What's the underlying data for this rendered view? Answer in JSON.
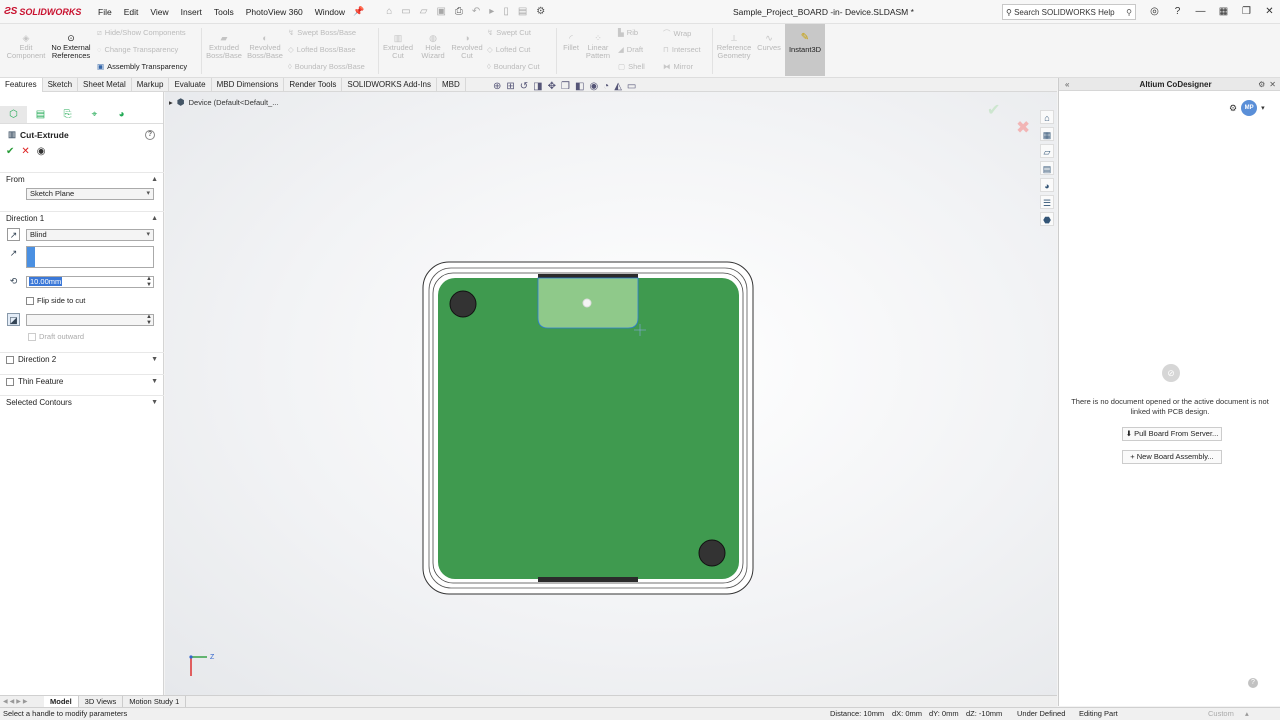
{
  "app": {
    "logo": "SOLIDWORKS",
    "doc_title": "Sample_Project_BOARD -in- Device.SLDASM *",
    "menu": [
      "File",
      "Edit",
      "View",
      "Insert",
      "Tools",
      "PhotoView 360",
      "Window"
    ],
    "search_placeholder": "Search SOLIDWORKS Help"
  },
  "ribbon": {
    "edit_component": "Edit Component",
    "no_external_refs": "No External References",
    "hide_show": "Hide/Show Components",
    "change_transparency": "Change Transparency",
    "assembly_transparency": "Assembly Transparency",
    "extruded_boss": "Extruded Boss/Base",
    "revolved_boss": "Revolved Boss/Base",
    "swept_boss": "Swept Boss/Base",
    "lofted_boss": "Lofted Boss/Base",
    "boundary_boss": "Boundary Boss/Base",
    "extruded_cut": "Extruded Cut",
    "hole_wizard": "Hole Wizard",
    "revolved_cut": "Revolved Cut",
    "swept_cut": "Swept Cut",
    "lofted_cut": "Lofted Cut",
    "boundary_cut": "Boundary Cut",
    "fillet": "Fillet",
    "linear_pattern": "Linear Pattern",
    "rib": "Rib",
    "draft": "Draft",
    "shell": "Shell",
    "wrap": "Wrap",
    "intersect": "Intersect",
    "mirror": "Mirror",
    "reference_geometry": "Reference Geometry",
    "curves": "Curves",
    "instant3d": "Instant3D"
  },
  "tabs": [
    "Features",
    "Sketch",
    "Sheet Metal",
    "Markup",
    "Evaluate",
    "MBD Dimensions",
    "Render Tools",
    "SOLIDWORKS Add-Ins",
    "MBD"
  ],
  "property_manager": {
    "title": "Cut-Extrude",
    "from_label": "From",
    "from_value": "Sketch Plane",
    "direction1_label": "Direction 1",
    "end_condition": "Blind",
    "depth": "10.00mm",
    "flip_side": "Flip side to cut",
    "draft_outward": "Draft outward",
    "direction2_label": "Direction 2",
    "thin_feature": "Thin Feature",
    "selected_contours": "Selected Contours"
  },
  "graphics": {
    "tree_label": "Device  (Default<Default_..."
  },
  "triad": {
    "z_label": "Z"
  },
  "task_pane": {
    "title": "Altium CoDesigner",
    "avatar": "MP",
    "no_doc_msg": "There is no document opened or the active document is not linked with PCB design.",
    "pull_btn": "Pull Board From Server...",
    "new_btn": "New Board Assembly..."
  },
  "bottom_tabs": [
    "Model",
    "3D Views",
    "Motion Study 1"
  ],
  "status": {
    "left": "Select a handle to modify parameters",
    "distance": "Distance: 10mm",
    "dx": "dX: 0mm",
    "dy": "dY: 0mm",
    "dz": "dZ: -10mm",
    "defined": "Under Defined",
    "mode": "Editing Part",
    "custom": "Custom"
  },
  "colors": {
    "pcb_green": "#3f9a4f",
    "cut_region": "#8fc98a",
    "accent_blue": "#4a90e2"
  }
}
